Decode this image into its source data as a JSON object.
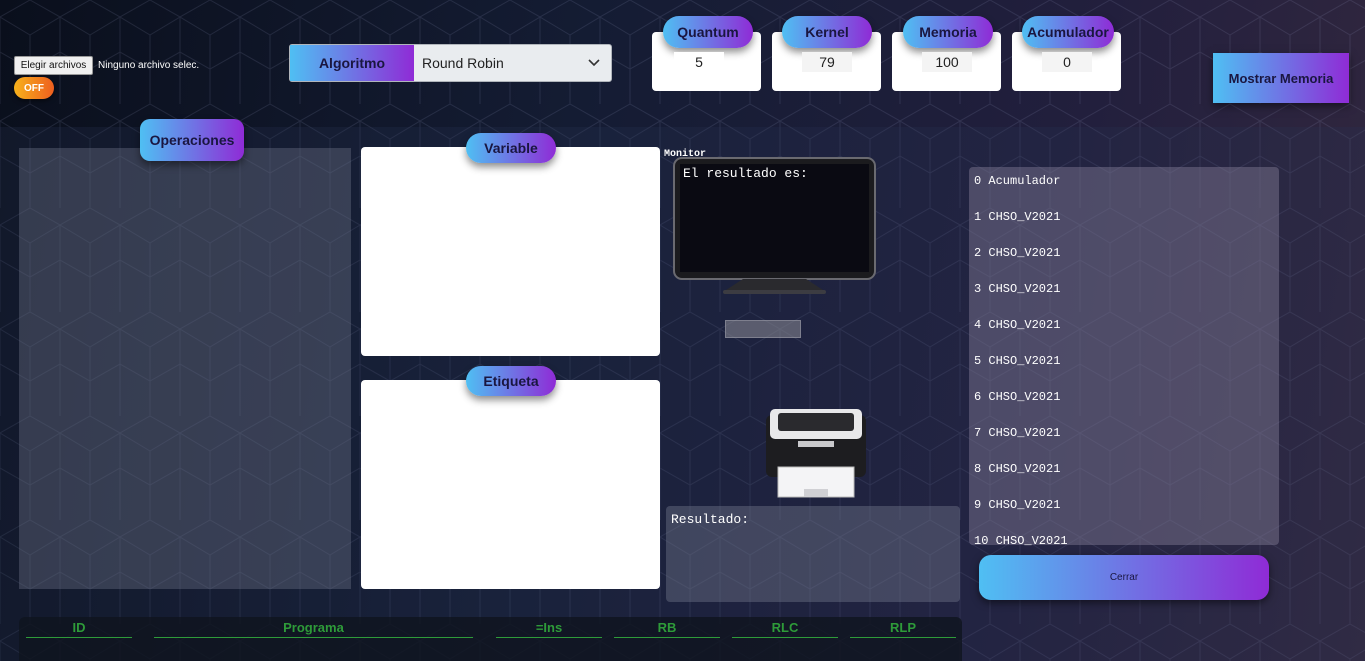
{
  "file_input": {
    "button_label": "Elegir archivos",
    "status": "Ninguno archivo selec."
  },
  "toggle": {
    "label": "OFF"
  },
  "algorithm": {
    "label": "Algoritmo",
    "selected": "Round Robin"
  },
  "stats": [
    {
      "label": "Quantum",
      "value": "5"
    },
    {
      "label": "Kernel",
      "value": "79"
    },
    {
      "label": "Memoria",
      "value": "100"
    },
    {
      "label": "Acumulador",
      "value": "0"
    }
  ],
  "show_memory_button": "Mostrar Memoria",
  "operations_label": "Operaciones",
  "variable_label": "Variable",
  "etiqueta_label": "Etiqueta",
  "monitor": {
    "label": "Monitor",
    "screen_text": "El resultado es:"
  },
  "result_label": "Resultado:",
  "memory_items": [
    "0 Acumulador",
    "1 CHSO_V2021",
    "2 CHSO_V2021",
    "3 CHSO_V2021",
    "4 CHSO_V2021",
    "5 CHSO_V2021",
    "6 CHSO_V2021",
    "7 CHSO_V2021",
    "8 CHSO_V2021",
    "9 CHSO_V2021",
    "10 CHSO_V2021"
  ],
  "close_button": "Cerrar",
  "table_headers": [
    "ID",
    "Programa",
    "=Ins",
    "RB",
    "RLC",
    "RLP"
  ],
  "colors": {
    "accent_start": "#4fbff3",
    "accent_end": "#8f2bd6",
    "table_header": "#2e9b39",
    "toggle": "#f08a1c"
  },
  "icons": [
    "monitor-icon",
    "printer-icon",
    "chevron-down-icon"
  ]
}
